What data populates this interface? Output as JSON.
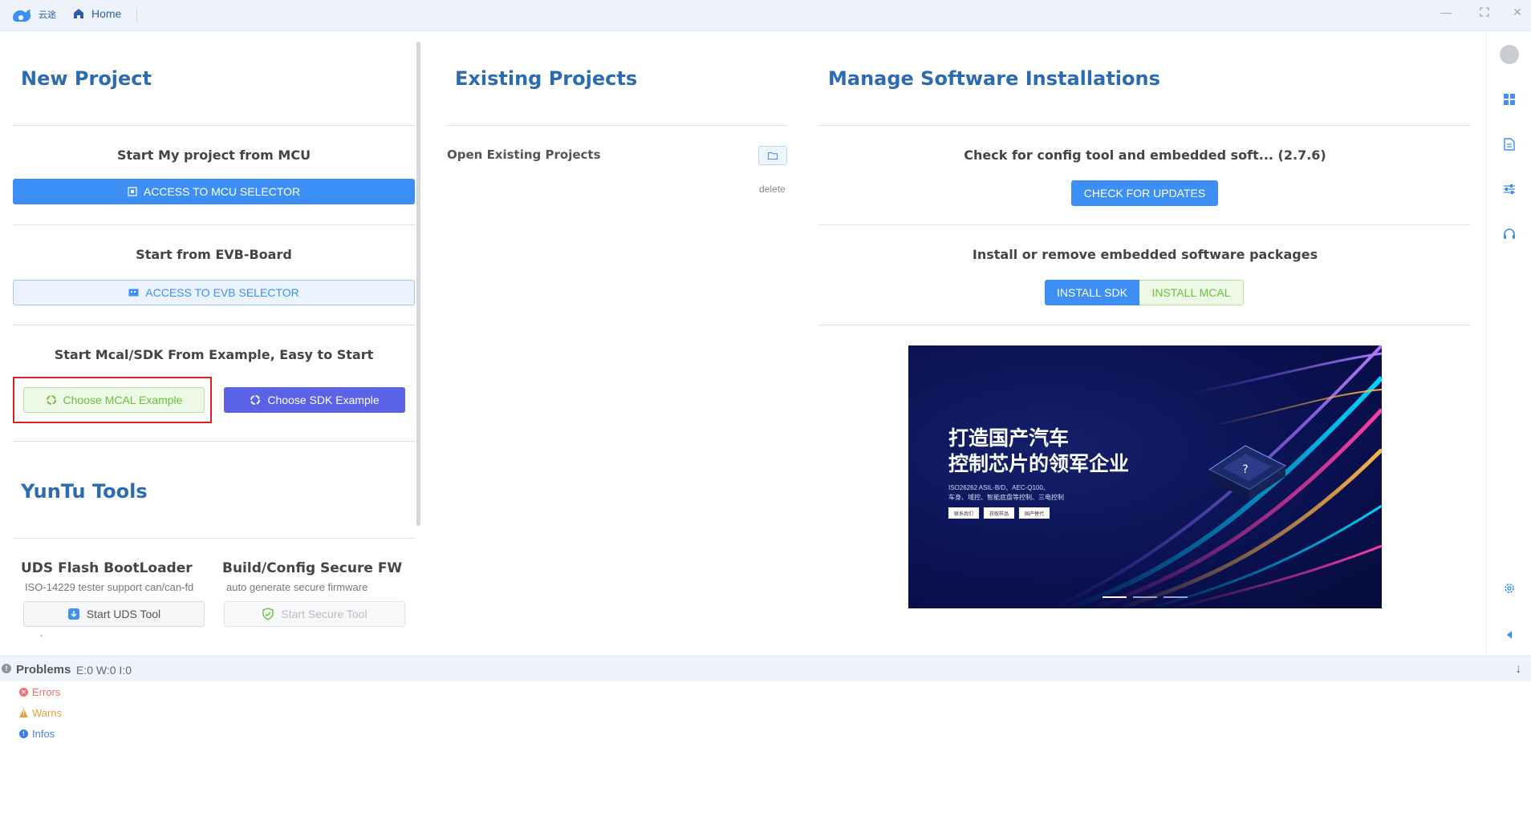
{
  "titlebar": {
    "logo_text": "云途",
    "home_label": "Home"
  },
  "new_project": {
    "title": "New Project",
    "mcu_heading": "Start My project from MCU",
    "mcu_button": "ACCESS TO MCU SELECTOR",
    "evb_heading": "Start from EVB-Board",
    "evb_button": "ACCESS TO EVB SELECTOR",
    "example_heading": "Start Mcal/SDK From Example, Easy to Start",
    "mcal_example_button": "Choose MCAL Example",
    "sdk_example_button": "Choose SDK Example"
  },
  "tools": {
    "title": "YunTu Tools",
    "uds": {
      "title": "UDS Flash BootLoader",
      "desc": "ISO-14229 tester support can/can-fd",
      "button": "Start UDS Tool"
    },
    "secure": {
      "title": "Build/Config Secure FW",
      "desc": "auto generate secure firmware",
      "button": "Start Secure Tool"
    },
    "trailing_mark": "-"
  },
  "existing": {
    "title": "Existing Projects",
    "open_label": "Open Existing Projects",
    "delete_label": "delete"
  },
  "manage": {
    "title": "Manage Software Installations",
    "check_heading": "Check for config tool and embedded soft... (2.7.6)",
    "check_button": "CHECK FOR UPDATES",
    "install_heading": "Install or remove embedded software packages",
    "install_sdk": "INSTALL SDK",
    "install_mcal": "INSTALL MCAL"
  },
  "banner": {
    "headline_1": "打造国产汽车",
    "headline_2": "控制芯片的领军企业",
    "line_1": "ISO26262 ASIL-B/D、AEC-Q100、",
    "line_2": "车身、域控、智能底盘等控制、三电控制",
    "chip_buttons": [
      "联系我们",
      "获取样品",
      "国产替代"
    ],
    "chip_glyph": "?",
    "slides_total": 3,
    "active_slide": 1
  },
  "problems": {
    "title": "Problems",
    "counts": "E:0 W:0 I:0",
    "items": [
      {
        "label": "Errors",
        "color": "#f56c6c",
        "glyph": "✕"
      },
      {
        "label": "Warns",
        "color": "#e6a23c",
        "glyph": "!"
      },
      {
        "label": "Infos",
        "color": "#3d7ee8",
        "glyph": "!"
      }
    ]
  },
  "colors": {
    "accent": "#3d8ff5",
    "title_blue": "#2b6cb0",
    "purple": "#5a63e6",
    "green": "#67c23a",
    "highlight_red": "#e02020"
  }
}
